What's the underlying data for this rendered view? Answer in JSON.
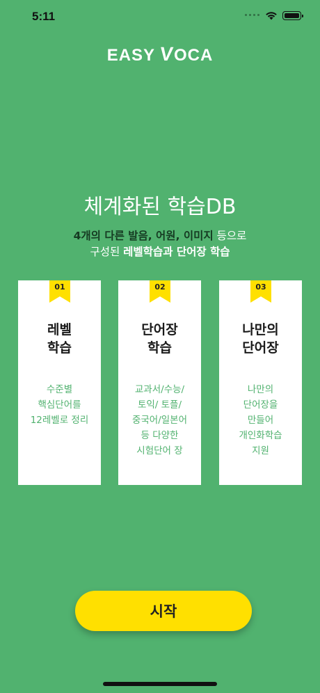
{
  "status": {
    "time": "5:11"
  },
  "logo": {
    "part1": "EASY ",
    "v": "V",
    "part2": "OCA"
  },
  "headline": "체계화된 학습DB",
  "subtitle": {
    "line1_bold": "4개의 다른 발음, 어원, 이미지",
    "line1_rest": " 등으로",
    "line2_start": "구성된 ",
    "line2_bold": "레벨학습과 단어장 학습"
  },
  "cards": [
    {
      "number": "01",
      "title": [
        "레벨",
        "학습"
      ],
      "desc": [
        "수준별",
        "핵심단어를",
        "12레벨로 정리"
      ]
    },
    {
      "number": "02",
      "title": [
        "단어장",
        "학습"
      ],
      "desc": [
        "교과서/수능/",
        "토익/ 토플/",
        "중국어/일본어",
        "등 다양한",
        "시험단어 장"
      ]
    },
    {
      "number": "03",
      "title": [
        "나만의",
        "단어장"
      ],
      "desc": [
        "나만의",
        "단어장을",
        "만들어",
        "개인화학습",
        "지원"
      ]
    }
  ],
  "start_button": "시작",
  "colors": {
    "background": "#51b26f",
    "accent": "#ffe000",
    "card": "#ffffff",
    "dark_text": "#153a22"
  },
  "icons": [
    "wifi-icon",
    "battery-icon",
    "signal-icon"
  ]
}
